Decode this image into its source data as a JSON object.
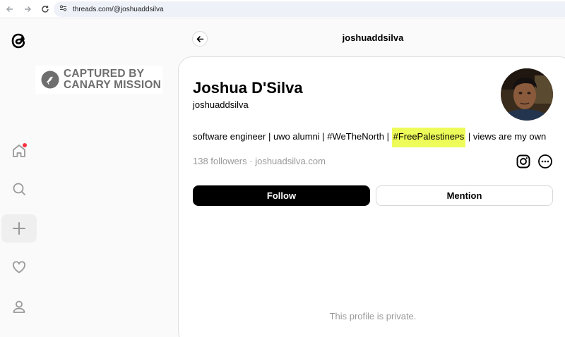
{
  "browser": {
    "url": "threads.com/@joshuaddsilva"
  },
  "watermark": {
    "line1": "CAPTURED BY",
    "line2": "CANARY MISSION"
  },
  "header": {
    "title": "joshuaddsilva"
  },
  "profile": {
    "name": "Joshua D'Silva",
    "handle": "joshuaddsilva",
    "bio_before": "software engineer | uwo alumni | #WeTheNorth | ",
    "bio_highlight": "#FreePalestineᴘs",
    "bio_after": " | views are my own",
    "followers": "138 followers",
    "separator": "·",
    "website": "joshuadsilva.com",
    "follow_label": "Follow",
    "mention_label": "Mention",
    "private_notice": "This profile is private."
  },
  "sidebar": {
    "items": [
      "home",
      "search",
      "create",
      "activity",
      "profile"
    ]
  },
  "colors": {
    "highlight": "#eefc5a",
    "notification_dot": "#ff3040",
    "follow_button": "#000000"
  }
}
